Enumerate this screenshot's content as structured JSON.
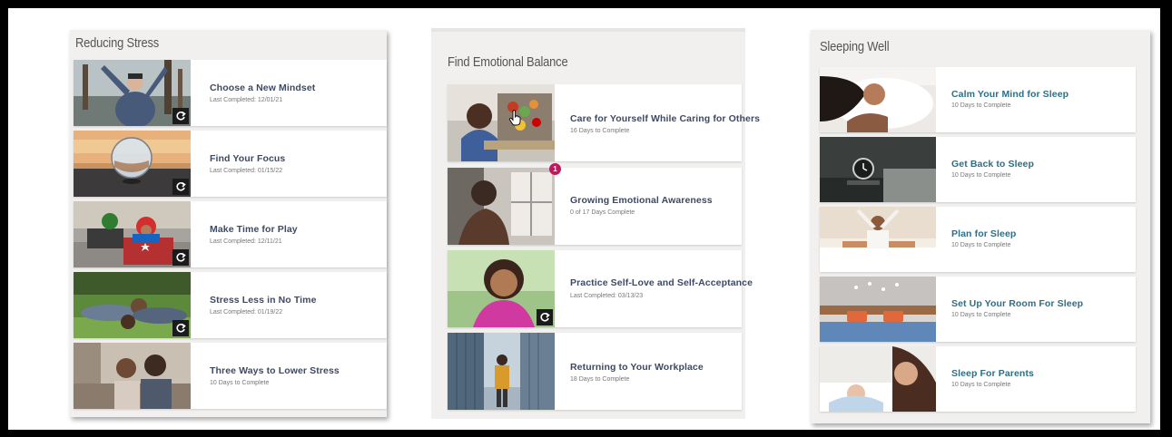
{
  "colors": {
    "title_slate": "#3d4a63",
    "title_teal": "#2e6e86",
    "notification": "#c2185b"
  },
  "panels": [
    {
      "title": "Reducing Stress",
      "cards": [
        {
          "title": "Choose a New Mindset",
          "subtitle": "Last Completed: 12/01/21",
          "redo": true,
          "icon": "redo-icon"
        },
        {
          "title": "Find Your Focus",
          "subtitle": "Last Completed: 01/15/22",
          "redo": true,
          "icon": "redo-icon"
        },
        {
          "title": "Make Time for Play",
          "subtitle": "Last Completed: 12/11/21",
          "redo": true,
          "icon": "redo-icon"
        },
        {
          "title": "Stress Less in No Time",
          "subtitle": "Last Completed: 01/19/22",
          "redo": true,
          "icon": "redo-icon"
        },
        {
          "title": "Three Ways to Lower Stress",
          "subtitle": "10 Days to Complete",
          "redo": false
        }
      ]
    },
    {
      "title": "Find Emotional Balance",
      "cards": [
        {
          "title": "Care for Yourself While Caring for Others",
          "subtitle": "16 Days to Complete",
          "redo": false,
          "icon": "hand-cursor-icon"
        },
        {
          "title": "Growing Emotional Awareness",
          "subtitle": "0 of 17 Days Complete",
          "redo": false,
          "badge": "1"
        },
        {
          "title": "Practice Self-Love and Self-Acceptance",
          "subtitle": "Last Completed: 03/13/23",
          "redo": true,
          "icon": "redo-icon"
        },
        {
          "title": "Returning to Your Workplace",
          "subtitle": "18 Days to Complete",
          "redo": false
        }
      ]
    },
    {
      "title": "Sleeping Well",
      "cards": [
        {
          "title": "Calm Your Mind for Sleep",
          "subtitle": "10 Days to Complete",
          "redo": false
        },
        {
          "title": "Get Back to Sleep",
          "subtitle": "10 Days to Complete",
          "redo": false
        },
        {
          "title": "Plan for Sleep",
          "subtitle": "10 Days to Complete",
          "redo": false
        },
        {
          "title": "Set Up Your Room For Sleep",
          "subtitle": "10 Days to Complete",
          "redo": false
        },
        {
          "title": "Sleep For Parents",
          "subtitle": "10 Days to Complete",
          "redo": false
        }
      ]
    }
  ]
}
